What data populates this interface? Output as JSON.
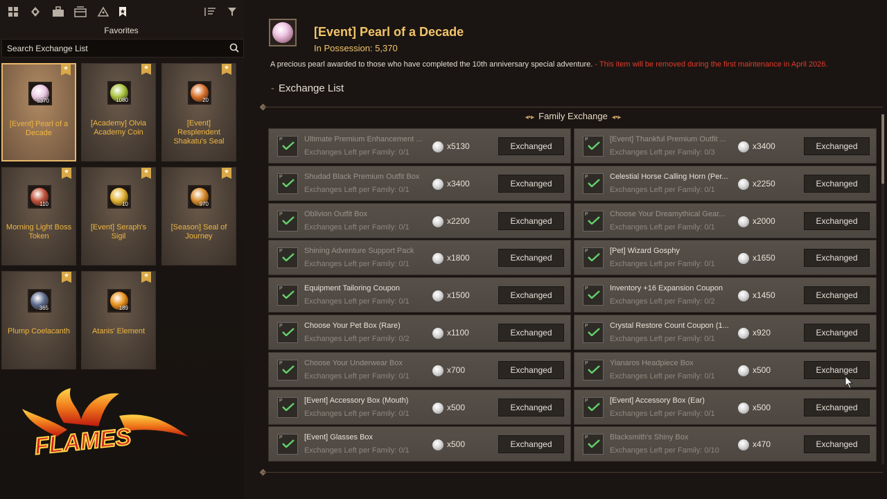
{
  "toolbar": {
    "icons": [
      "grid-icon",
      "map-pin-icon",
      "briefcase-icon",
      "box-icon",
      "tree-icon",
      "bookmark-icon",
      "sort-icon",
      "filter-icon"
    ],
    "favorites_label": "Favorites"
  },
  "search": {
    "placeholder": "Search Exchange List"
  },
  "cards": [
    {
      "name": "[Event] Pearl of a Decade",
      "count": "5370",
      "color": "#e9c6e0",
      "selected": true
    },
    {
      "name": "[Academy] Olvia Academy Coin",
      "count": "1080",
      "color": "#a6c23a"
    },
    {
      "name": "[Event] Resplendent Shakatu's Seal",
      "count": "20",
      "color": "#d8702a"
    },
    {
      "name": "Morning Light Boss Token",
      "count": "110",
      "color": "#c0503a"
    },
    {
      "name": "[Event] Seraph's Sigil",
      "count": "10",
      "color": "#e0b030"
    },
    {
      "name": "[Season] Seal of Journey",
      "count": "970",
      "color": "#d88a2a"
    },
    {
      "name": "Plump Coelacanth",
      "count": "365",
      "color": "#5a6a8a"
    },
    {
      "name": "Atanis' Element",
      "count": "189",
      "color": "#e8901a"
    }
  ],
  "logo": {
    "text": "FLAMES"
  },
  "item": {
    "title": "[Event] Pearl of a Decade",
    "possession": "In Possession: 5,370",
    "description": "A precious pearl awarded to those who have completed the 10th anniversary special adventure.",
    "warning": " - This item will be removed during the first maintenance in April 2026."
  },
  "exchange_list_title": "Exchange List",
  "section_title": "Family Exchange",
  "button_label": "Exchanged",
  "rows": [
    {
      "name": "Ultimate Premium Enhancement ...",
      "left": "Exchanges Left per Family: 0/1",
      "cost": "x5130",
      "bright": false
    },
    {
      "name": "[Event] Thankful Premium Outfit ...",
      "left": "Exchanges Left per Family: 0/3",
      "cost": "x3400",
      "bright": false
    },
    {
      "name": "Shudad Black Premium Outfit Box",
      "left": "Exchanges Left per Family: 0/1",
      "cost": "x3400",
      "bright": false
    },
    {
      "name": "Celestial Horse Calling Horn (Per...",
      "left": "Exchanges Left per Family: 0/1",
      "cost": "x2250",
      "bright": true
    },
    {
      "name": "Oblivion Outfit Box",
      "left": "Exchanges Left per Family: 0/1",
      "cost": "x2200",
      "bright": false
    },
    {
      "name": "Choose Your Dreamythical Gear...",
      "left": "Exchanges Left per Family: 0/1",
      "cost": "x2000",
      "bright": false
    },
    {
      "name": "Shining Adventure Support Pack",
      "left": "Exchanges Left per Family: 0/1",
      "cost": "x1800",
      "bright": false
    },
    {
      "name": "[Pet] Wizard Gosphy",
      "left": "Exchanges Left per Family: 0/1",
      "cost": "x1650",
      "bright": true
    },
    {
      "name": "Equipment Tailoring Coupon",
      "left": "Exchanges Left per Family: 0/1",
      "cost": "x1500",
      "bright": true
    },
    {
      "name": "Inventory +16 Expansion Coupon",
      "left": "Exchanges Left per Family: 0/2",
      "cost": "x1450",
      "bright": true
    },
    {
      "name": "Choose Your Pet Box (Rare)",
      "left": "Exchanges Left per Family: 0/2",
      "cost": "x1100",
      "bright": true
    },
    {
      "name": "Crystal Restore Count Coupon (1...",
      "left": "Exchanges Left per Family: 0/1",
      "cost": "x920",
      "bright": true
    },
    {
      "name": "Choose Your Underwear Box",
      "left": "Exchanges Left per Family: 0/1",
      "cost": "x700",
      "bright": false
    },
    {
      "name": "Yianaros Headpiece Box",
      "left": "Exchanges Left per Family: 0/1",
      "cost": "x500",
      "bright": false
    },
    {
      "name": "[Event] Accessory Box (Mouth)",
      "left": "Exchanges Left per Family: 0/1",
      "cost": "x500",
      "bright": true
    },
    {
      "name": "[Event] Accessory Box (Ear)",
      "left": "Exchanges Left per Family: 0/1",
      "cost": "x500",
      "bright": true
    },
    {
      "name": "[Event] Glasses Box",
      "left": "Exchanges Left per Family: 0/1",
      "cost": "x500",
      "bright": true
    },
    {
      "name": "Blacksmith's Shiny Box",
      "left": "Exchanges Left per Family: 0/10",
      "cost": "x470",
      "bright": false
    }
  ]
}
